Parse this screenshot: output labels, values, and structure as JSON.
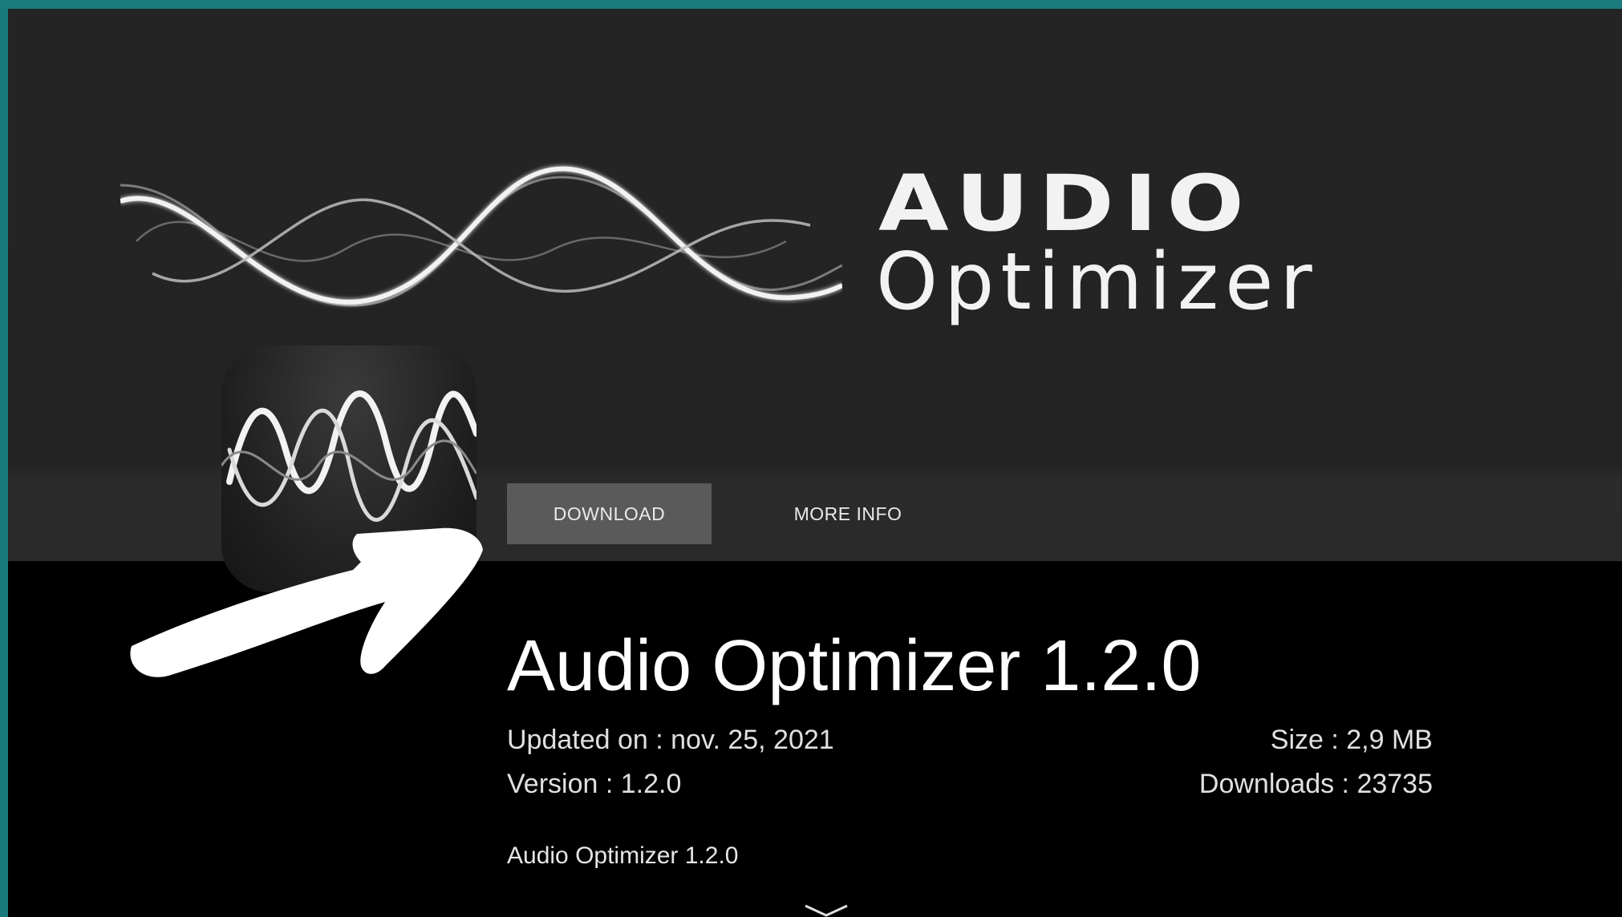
{
  "banner": {
    "brand_line1": "AUDIO",
    "brand_line2": "Optimizer"
  },
  "actions": {
    "download_label": "DOWNLOAD",
    "more_info_label": "MORE INFO"
  },
  "app": {
    "title": "Audio Optimizer 1.2.0",
    "updated": "Updated on : nov. 25, 2021",
    "version": "Version : 1.2.0",
    "size": "Size : 2,9 MB",
    "downloads": "Downloads : 23735",
    "description": "Audio Optimizer 1.2.0"
  },
  "icons": [
    "wave-logo-icon",
    "app-icon",
    "pointing-arrow-icon",
    "chevron-down-icon"
  ],
  "colors": {
    "frame_border": "#1b7a7c",
    "banner_bg": "#232323",
    "content_bg": "#000000",
    "download_button_bg": "#5a5a5a",
    "text": "#ffffff"
  }
}
